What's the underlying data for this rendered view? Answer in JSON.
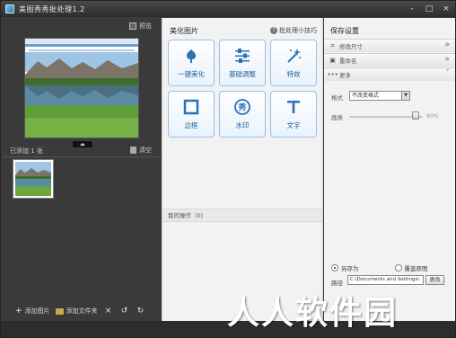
{
  "window": {
    "title": "美图秀秀批处理1.2",
    "controls": [
      "-",
      "□",
      "×"
    ]
  },
  "left_panel": {
    "preview_label": "预览",
    "added_count": "已添加 1 张",
    "clear_label": "清空",
    "add_image_label": "添加图片",
    "add_folder_label": "添加文件夹",
    "delete_icon": "×",
    "rotate_left_icon": "↺",
    "rotate_right_icon": "↻"
  },
  "center_panel": {
    "title": "美化图片",
    "tips_label": "批处理小技巧",
    "tools": [
      {
        "label": "一键美化",
        "icon": "tulip-icon"
      },
      {
        "label": "基础调整",
        "icon": "sliders-icon"
      },
      {
        "label": "特效",
        "icon": "magic-wand-icon"
      },
      {
        "label": "边框",
        "icon": "frame-icon"
      },
      {
        "label": "水印",
        "icon": "watermark-icon"
      },
      {
        "label": "文字",
        "icon": "text-icon"
      }
    ],
    "operations_label": "我的操作（0）"
  },
  "right_panel": {
    "title": "保存设置",
    "sections": [
      {
        "label": "修改尺寸",
        "icon": "crop-icon",
        "chevron": "»"
      },
      {
        "label": "重命名",
        "icon": "rename-icon",
        "chevron": "»"
      },
      {
        "label": "更多",
        "icon": "more-icon",
        "chevron": "»"
      }
    ],
    "format_label": "格式",
    "format_value": "不改变格式",
    "quality_label": "画质",
    "quality_value": "90%",
    "quality_fraction": 0.9,
    "save_as_label": "另存为",
    "overwrite_label": "覆盖原图",
    "path_label": "路径",
    "path_value": "C:\\Documents and Settings\\",
    "change_label": "更改"
  },
  "watermark_text": "人人软件园",
  "colors": {
    "dark_bg": "#3a3a3a",
    "panel_bg": "#f2f2f2",
    "tool_border": "#98c0e4",
    "tool_label": "#1d5d98"
  }
}
